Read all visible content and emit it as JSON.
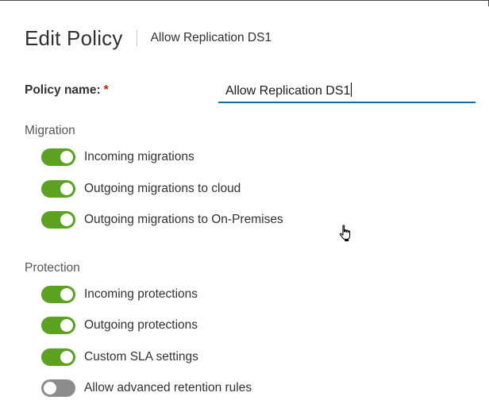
{
  "header": {
    "title": "Edit Policy",
    "subtitle": "Allow Replication DS1"
  },
  "form": {
    "policy_name_label": "Policy name:",
    "required_marker": "*",
    "policy_name_value": "Allow Replication DS1"
  },
  "migration": {
    "section_label": "Migration",
    "toggles": [
      {
        "label": "Incoming migrations",
        "on": true
      },
      {
        "label": "Outgoing migrations to cloud",
        "on": true
      },
      {
        "label": "Outgoing migrations to On-Premises",
        "on": true
      }
    ]
  },
  "protection": {
    "section_label": "Protection",
    "toggles": [
      {
        "label": "Incoming protections",
        "on": true
      },
      {
        "label": "Outgoing protections",
        "on": true
      },
      {
        "label": "Custom SLA settings",
        "on": true
      },
      {
        "label": "Allow advanced retention rules",
        "on": false
      }
    ]
  },
  "colors": {
    "toggle_on": "#5aa220",
    "toggle_off": "#8c8c8c",
    "input_underline": "#0072a3",
    "required": "#c92100"
  },
  "icons": {
    "cursor": "hand-pointer-cursor-icon"
  }
}
